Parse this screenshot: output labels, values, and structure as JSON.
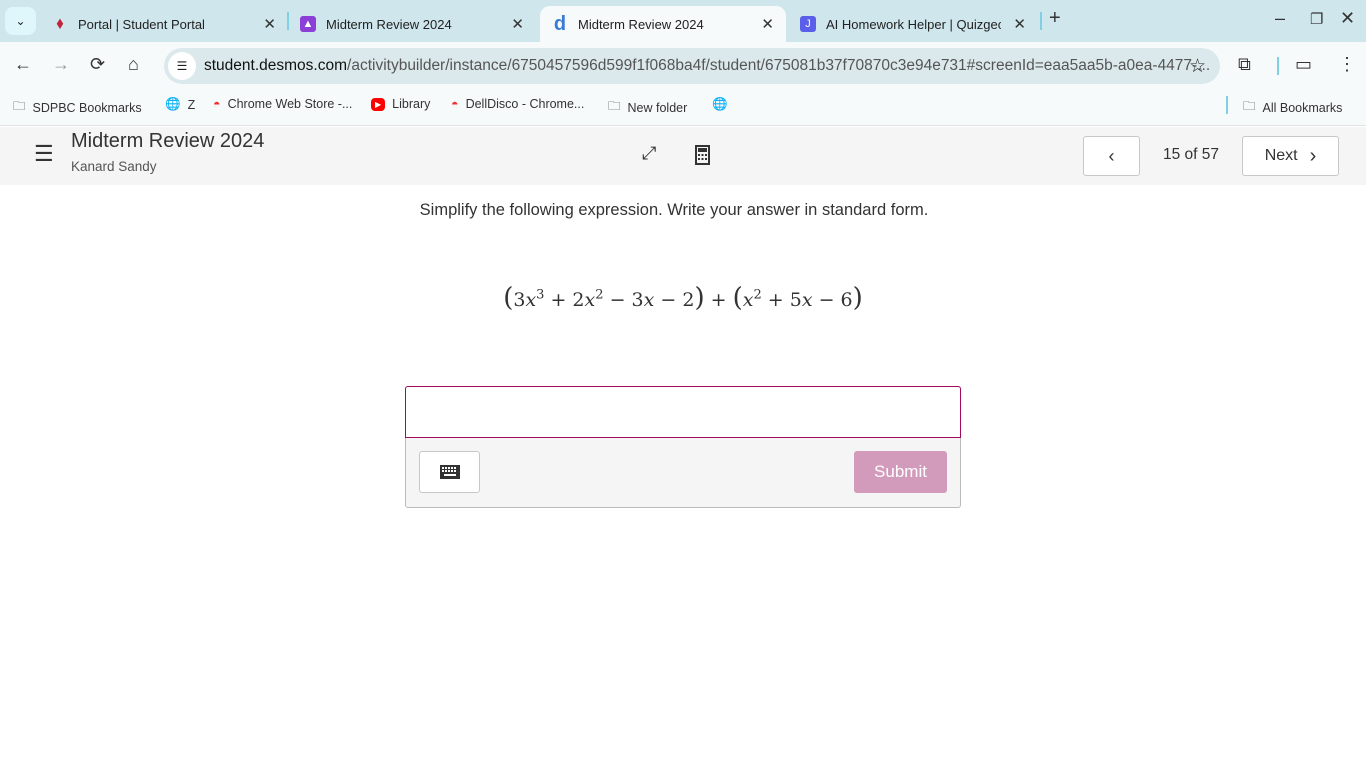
{
  "browser": {
    "tabs": [
      {
        "label": "Portal | Student Portal",
        "icon": "portal-shield-icon",
        "icon_color": "#c0243c"
      },
      {
        "label": "Midterm Review 2024",
        "icon": "classroom-icon",
        "icon_color": "#8b3fd6"
      },
      {
        "label": "Midterm Review 2024",
        "icon": "desmos-d-icon",
        "icon_color": "#3a7bd5",
        "active": true
      },
      {
        "label": "AI Homework Helper | Quizgeck",
        "icon": "quizgecko-icon",
        "icon_color": "#5a5ee8"
      }
    ],
    "url_host": "student.desmos.com",
    "url_path": "/activitybuilder/instance/6750457596d599f1f068ba4f/student/675081b37f70870c3e94e731#screenId=eaa5aa5b-a0ea-4477-...",
    "bookmarks": [
      {
        "label": "SDPBC Bookmarks",
        "icon": "folder-settings-icon"
      },
      {
        "label": "Z",
        "icon": "globe-icon"
      },
      {
        "label": "Chrome Web Store -...",
        "icon": "chrome-web-store-icon"
      },
      {
        "label": "Library",
        "icon": "youtube-icon"
      },
      {
        "label": "DellDisco - Chrome...",
        "icon": "chrome-web-store-icon"
      },
      {
        "label": "New folder",
        "icon": "folder-icon"
      },
      {
        "label": "",
        "icon": "globe-icon"
      }
    ],
    "all_bookmarks": "All Bookmarks"
  },
  "activity": {
    "title": "Midterm Review 2024",
    "student": "Kanard Sandy",
    "page": "15 of 57",
    "next": "Next",
    "prompt": "Simplify the following expression. Write your answer in standard form.",
    "answer_value": "",
    "submit": "Submit",
    "accent": "#a0095f"
  }
}
